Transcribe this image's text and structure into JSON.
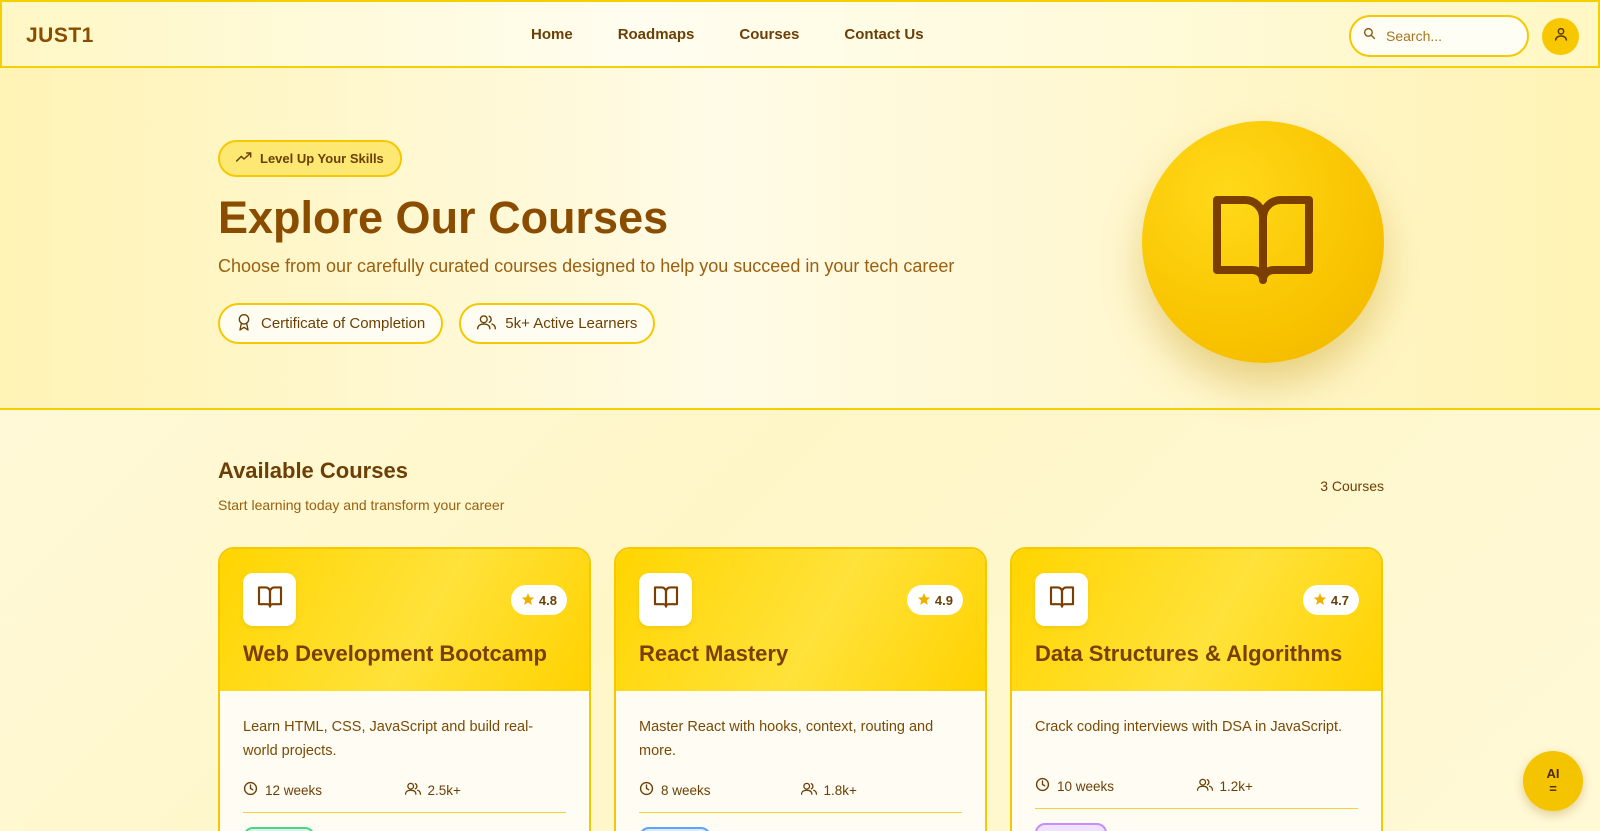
{
  "nav": {
    "logo": "JUST1",
    "links": [
      "Home",
      "Roadmaps",
      "Courses",
      "Contact Us"
    ],
    "search_placeholder": "Search..."
  },
  "hero": {
    "pill": "Level Up Your Skills",
    "title": "Explore Our Courses",
    "subtitle": "Choose from our carefully curated courses designed to help you succeed in your tech career",
    "badges": [
      "Certificate of Completion",
      "5k+ Active Learners"
    ]
  },
  "section": {
    "title": "Available Courses",
    "subtitle": "Start learning today and transform your career",
    "count": "3 Courses"
  },
  "courses": [
    {
      "title": "Web Development Bootcamp",
      "rating": "4.8",
      "description": "Learn HTML, CSS, JavaScript and build real-world projects.",
      "duration": "12 weeks",
      "learners": "2.5k+",
      "tag_color": "#4fd38a"
    },
    {
      "title": "React Mastery",
      "rating": "4.9",
      "description": "Master React with hooks, context, routing and more.",
      "duration": "8 weeks",
      "learners": "1.8k+",
      "tag_color": "#5aa7ff"
    },
    {
      "title": "Data Structures & Algorithms",
      "rating": "4.7",
      "description": "Crack coding interviews with DSA in JavaScript.",
      "duration": "10 weeks",
      "learners": "1.2k+",
      "tag_color": "#c98cff"
    }
  ],
  "ai_button": {
    "label": "AI",
    "sub": "="
  },
  "colors": {
    "accent": "#f5c800",
    "text_brown": "#7a4a05"
  }
}
